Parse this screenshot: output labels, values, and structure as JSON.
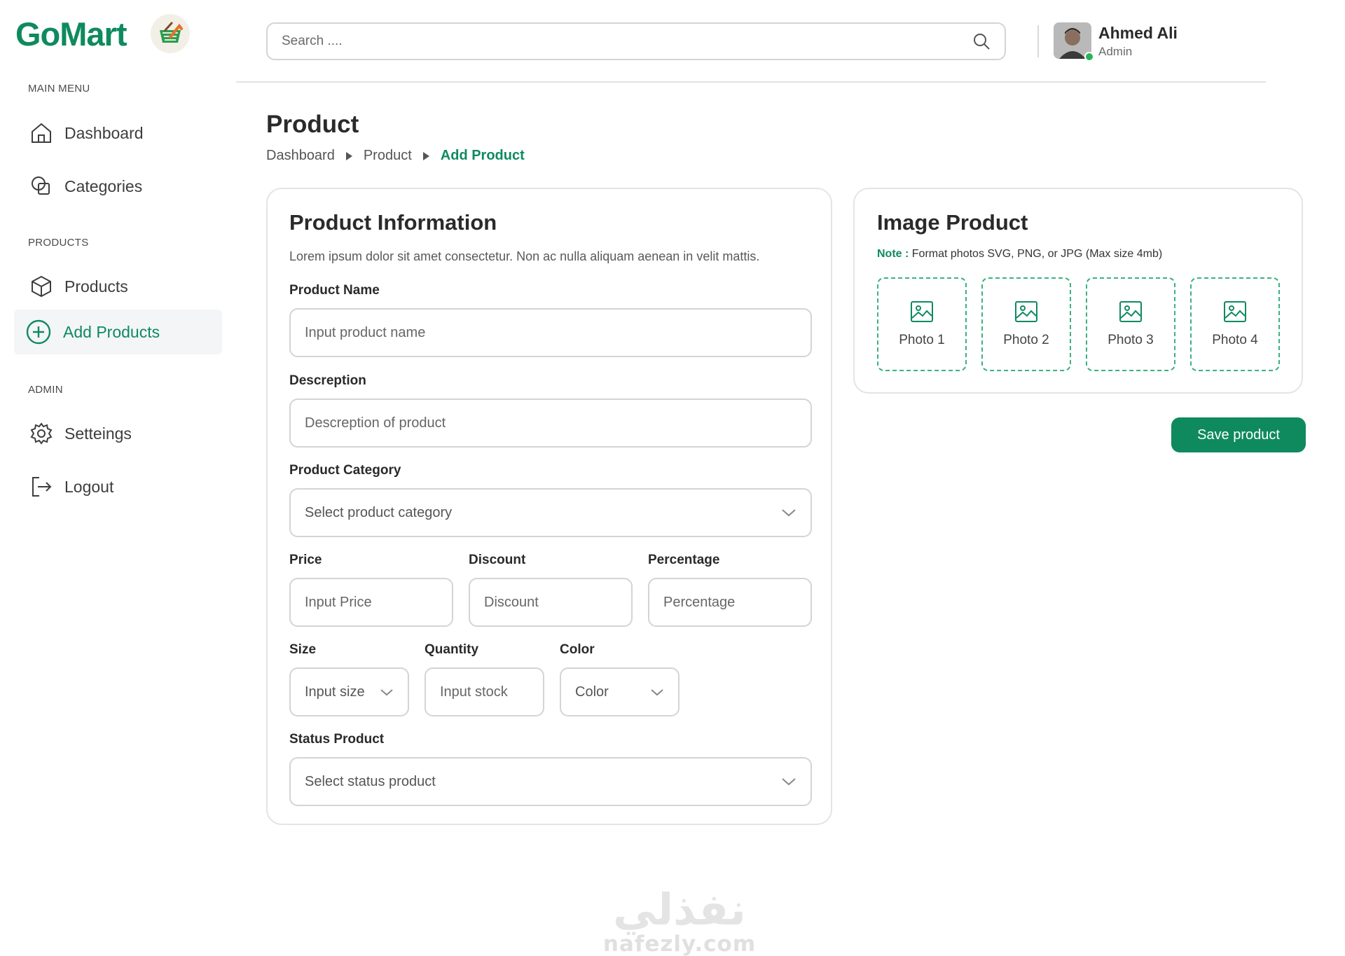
{
  "brand": {
    "name": "GoMart",
    "accent": "#0f8a5f"
  },
  "sidebar": {
    "sections": [
      {
        "label": "MAIN MENU",
        "items": [
          {
            "label": "Dashboard",
            "icon": "home-icon"
          },
          {
            "label": "Categories",
            "icon": "shapes-icon"
          }
        ]
      },
      {
        "label": "PRODUCTS",
        "items": [
          {
            "label": "Products",
            "icon": "box-icon"
          },
          {
            "label": "Add Products",
            "icon": "plus-circle-icon",
            "active": true
          }
        ]
      },
      {
        "label": "ADMIN",
        "items": [
          {
            "label": "Setteings",
            "icon": "gear-icon"
          },
          {
            "label": "Logout",
            "icon": "logout-icon"
          }
        ]
      }
    ]
  },
  "header": {
    "search": {
      "placeholder": "Search ...."
    },
    "user": {
      "name": "Ahmed Ali",
      "role": "Admin",
      "online": true
    }
  },
  "page": {
    "title": "Product",
    "breadcrumb": [
      "Dashboard",
      "Product",
      "Add Product"
    ]
  },
  "product_info": {
    "title": "Product Information",
    "subtitle": "Lorem ipsum dolor sit amet consectetur. Non ac nulla aliquam aenean in velit mattis.",
    "fields": {
      "name": {
        "label": "Product Name",
        "placeholder": "Input product name"
      },
      "description": {
        "label": "Descreption",
        "placeholder": "Descreption of product"
      },
      "category": {
        "label": "Product Category",
        "placeholder": "Select product category"
      },
      "price": {
        "label": "Price",
        "placeholder": "Input Price"
      },
      "discount": {
        "label": "Discount",
        "placeholder": "Discount"
      },
      "percentage": {
        "label": "Percentage",
        "placeholder": "Percentage"
      },
      "size": {
        "label": "Size",
        "placeholder": "Input size"
      },
      "quantity": {
        "label": "Quantity",
        "placeholder": "Input stock"
      },
      "color": {
        "label": "Color",
        "placeholder": "Color"
      },
      "status": {
        "label": "Status Product",
        "placeholder": "Select status  product"
      }
    }
  },
  "image_product": {
    "title": "Image Product",
    "note_label": "Note :",
    "note_text": "Format photos  SVG, PNG, or JPG (Max size 4mb)",
    "photos": [
      "Photo 1",
      "Photo 2",
      "Photo 3",
      "Photo 4"
    ]
  },
  "actions": {
    "save_label": "Save product"
  },
  "watermark": {
    "mark": "نفذلي",
    "url": "nafezly.com"
  }
}
